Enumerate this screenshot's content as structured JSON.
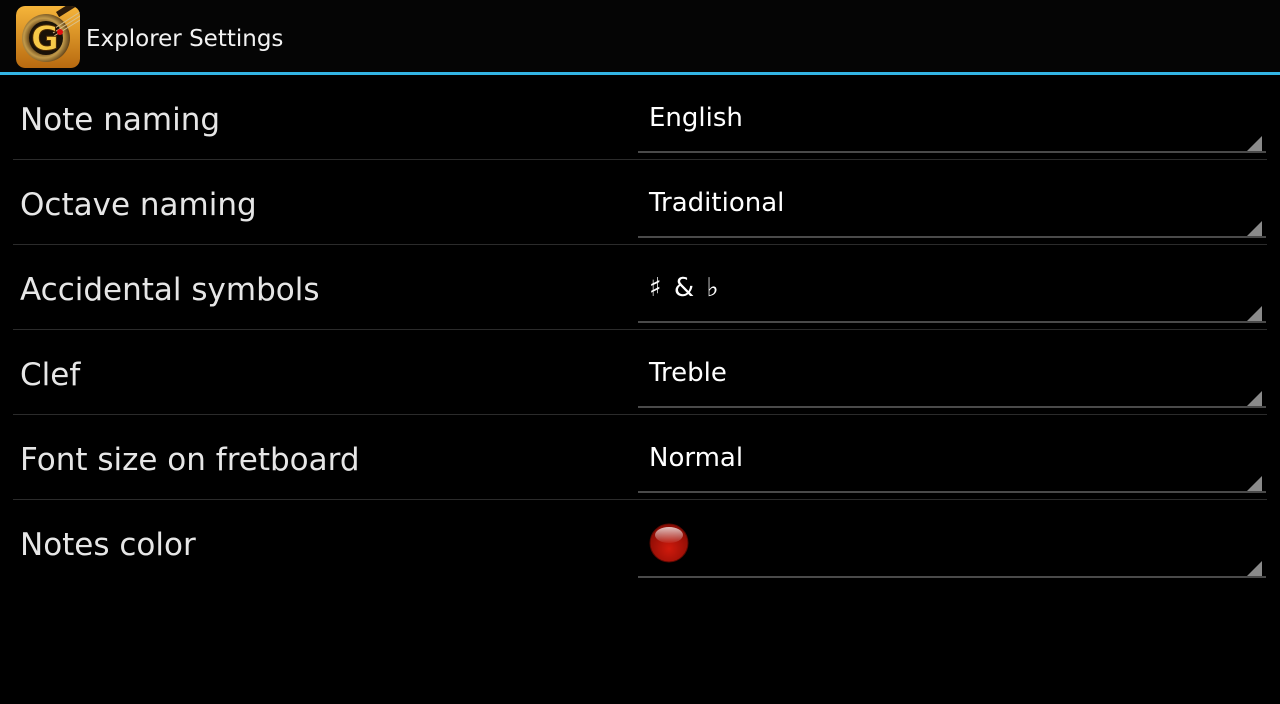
{
  "action_bar": {
    "title": "Explorer Settings",
    "app_icon": "guitar-g-app-icon",
    "accent_color": "#33b5e5"
  },
  "settings": [
    {
      "label": "Note naming",
      "value": "English"
    },
    {
      "label": "Octave naming",
      "value": "Traditional"
    },
    {
      "label": "Accidental symbols",
      "value": "♯ & ♭"
    },
    {
      "label": "Clef",
      "value": "Treble"
    },
    {
      "label": "Font size on fretboard",
      "value": "Normal"
    },
    {
      "label": "Notes color",
      "color": "#d01a0c",
      "icon": "red-note-color-swatch-icon"
    }
  ]
}
